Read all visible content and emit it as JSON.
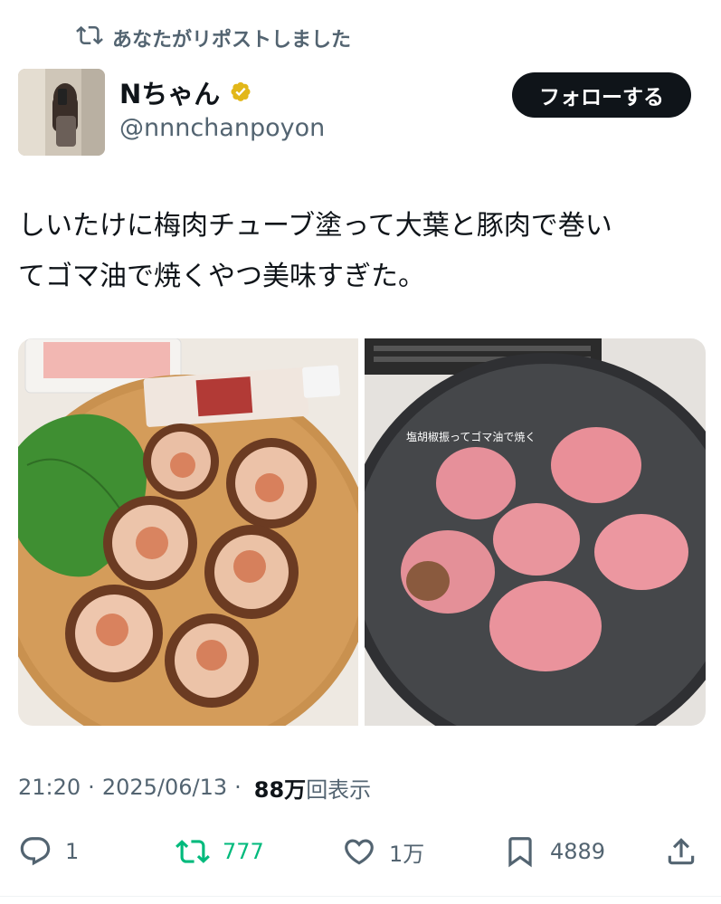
{
  "repost_banner": {
    "text": "あなたがリポストしました",
    "icon": "repost-icon"
  },
  "author": {
    "display_name": "Nちゃん",
    "handle": "@nnnchanpoyon",
    "verified": true,
    "verified_color": "#e2b719"
  },
  "follow_button": {
    "label": "フォローする"
  },
  "tweet": {
    "line1": "しいたけに梅肉チューブ塗って大葉と豚肉で巻い",
    "line2": "てゴマ油で焼くやつ美味すぎた。"
  },
  "media": {
    "overlay_caption": "塩胡椒振ってゴマ油で焼く"
  },
  "meta": {
    "time": "21:20",
    "date": "2025/06/13",
    "views_count": "88万",
    "views_label": "回表示",
    "separator": "·"
  },
  "actions": {
    "reply_count": "1",
    "repost_count": "777",
    "like_count": "1万",
    "bookmark_count": "4889"
  },
  "colors": {
    "text_primary": "#0f1419",
    "text_secondary": "#536471",
    "repost_green": "#00ba7c",
    "follow_bg": "#0f1419"
  }
}
